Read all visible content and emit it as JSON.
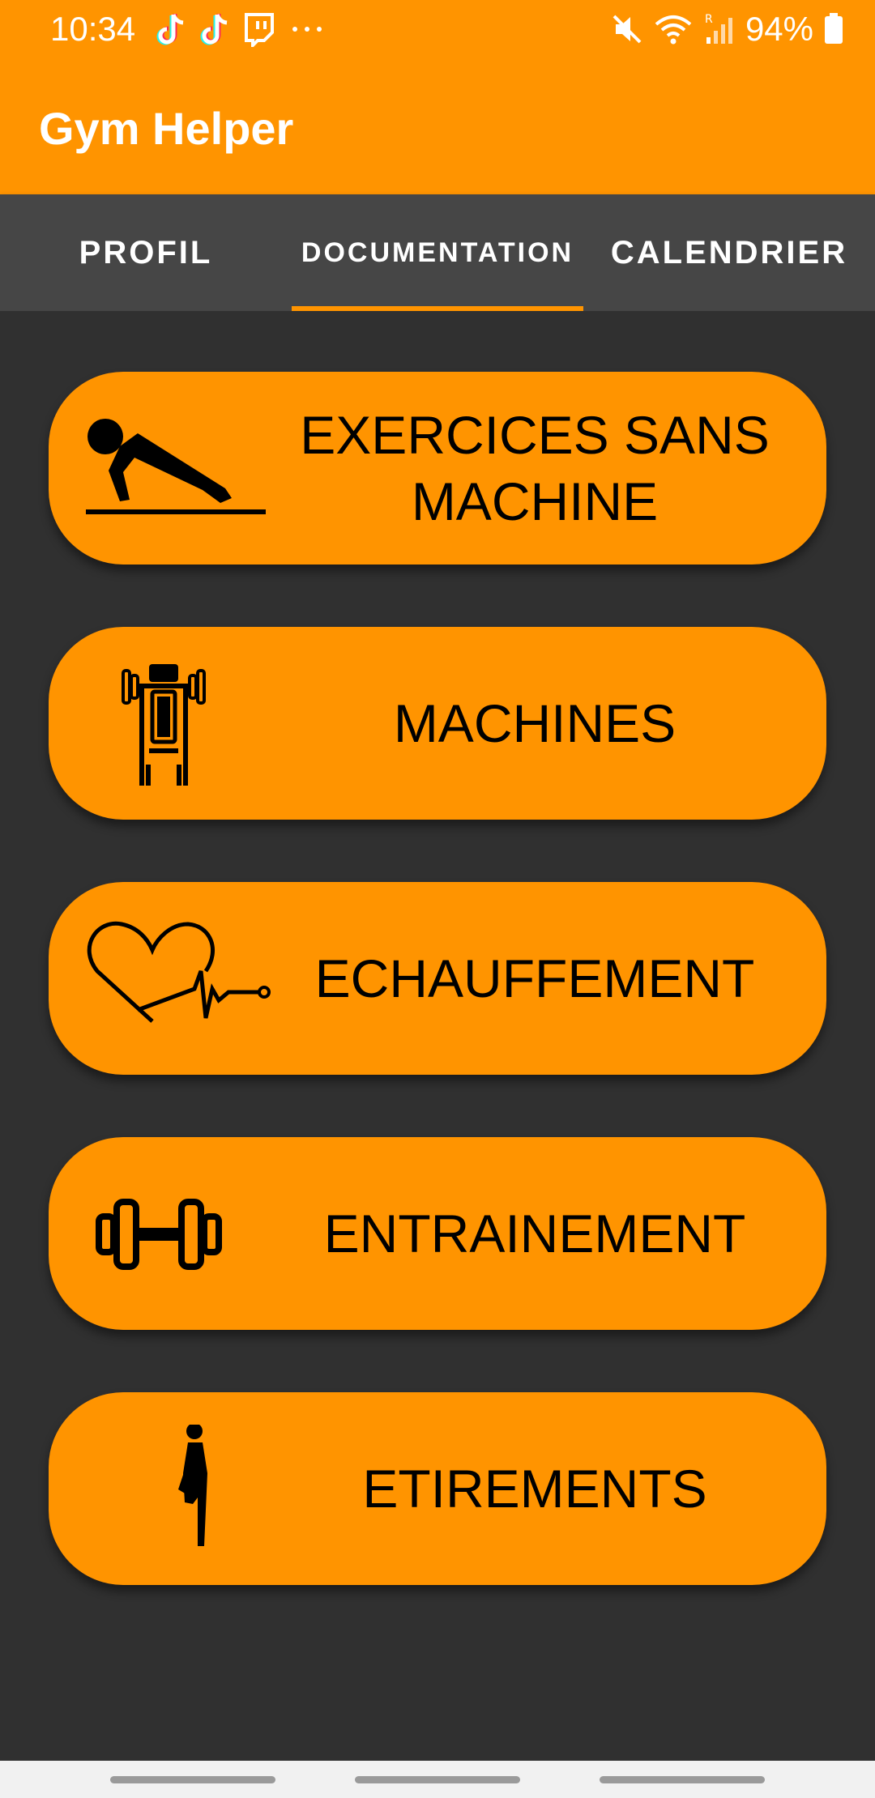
{
  "status_bar": {
    "time": "10:34",
    "battery": "94%",
    "notification_icons": [
      "tiktok-icon",
      "tiktok-icon",
      "twitch-icon",
      "more-icon"
    ],
    "system_icons": [
      "mute-icon",
      "wifi-icon",
      "roaming-signal-icon",
      "battery-icon"
    ]
  },
  "app_bar": {
    "title": "Gym Helper"
  },
  "tabs": [
    {
      "label": "PROFIL"
    },
    {
      "label": "DOCUMENTATION",
      "selected": true
    },
    {
      "label": "CALENDRIER"
    }
  ],
  "cards": [
    {
      "label": "EXERCICES SANS MACHINE",
      "icon": "pushup-icon"
    },
    {
      "label": "MACHINES",
      "icon": "weight-machine-icon"
    },
    {
      "label": "ECHAUFFEMENT",
      "icon": "heartbeat-icon"
    },
    {
      "label": "ENTRAINEMENT",
      "icon": "dumbbell-icon"
    },
    {
      "label": "ETIREMENTS",
      "icon": "stretching-icon"
    }
  ],
  "colors": {
    "accent": "#ff9400",
    "background": "#303030",
    "tab_bar": "#464646"
  }
}
